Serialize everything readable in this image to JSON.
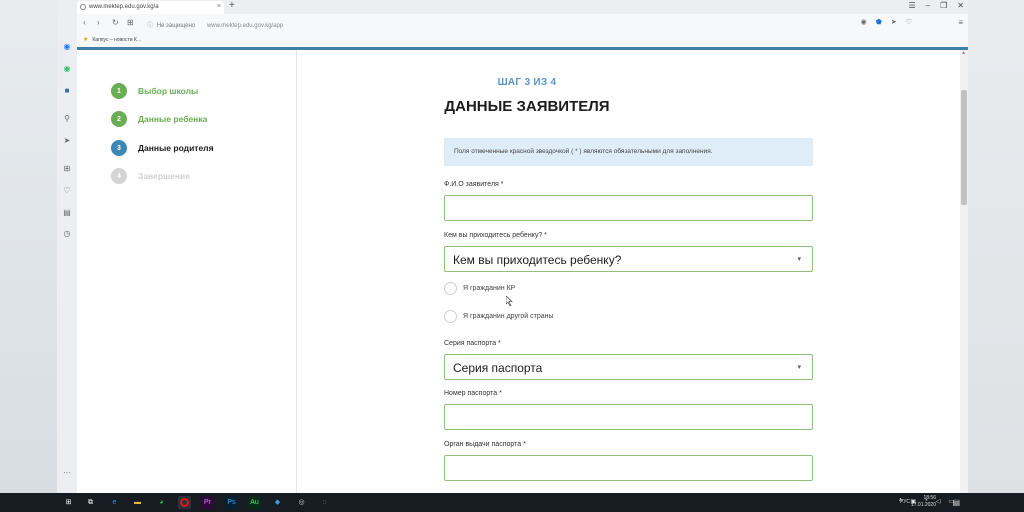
{
  "browser": {
    "tab_title": "www.mektep.edu.gov.kg/a",
    "address_security": "Не защищено",
    "address_url": "www.mektep.edu.gov.kg/app",
    "bookmark": "Каппус – новости К..."
  },
  "steps": [
    {
      "num": "1",
      "label": "Выбор школы",
      "state": "done"
    },
    {
      "num": "2",
      "label": "Данные ребенка",
      "state": "done"
    },
    {
      "num": "3",
      "label": "Данные родителя",
      "state": "current"
    },
    {
      "num": "4",
      "label": "Завершение",
      "state": "next"
    }
  ],
  "form": {
    "step_counter": "ШАГ 3 ИЗ 4",
    "title": "ДАННЫЕ ЗАЯВИТЕЛЯ",
    "info": "Поля отмеченные красной звездочкой ( * ) являются обязательными для заполнения.",
    "fio_label": "Ф.И.О заявителя *",
    "relation_label": "Кем вы приходитесь ребенку? *",
    "relation_value": "Кем вы приходитесь ребенку?",
    "citizen_kr": "Я гражданин КР",
    "citizen_other": "Я гражданин другой страны",
    "passport_series_label": "Серия паспорта *",
    "passport_series_value": "Серия паспорта",
    "passport_number_label": "Номер паспорта *",
    "passport_issuer_label": "Орган выдачи паспорта *"
  },
  "taskbar": {
    "lang": "РУС",
    "time": "18:56",
    "date": "17.01.2020"
  },
  "colors": {
    "step_done": "#69ad54",
    "step_current": "#3d86b5",
    "accent": "#3f7fa6",
    "info_bg": "#deedf7",
    "field_border": "#8fc07d"
  }
}
